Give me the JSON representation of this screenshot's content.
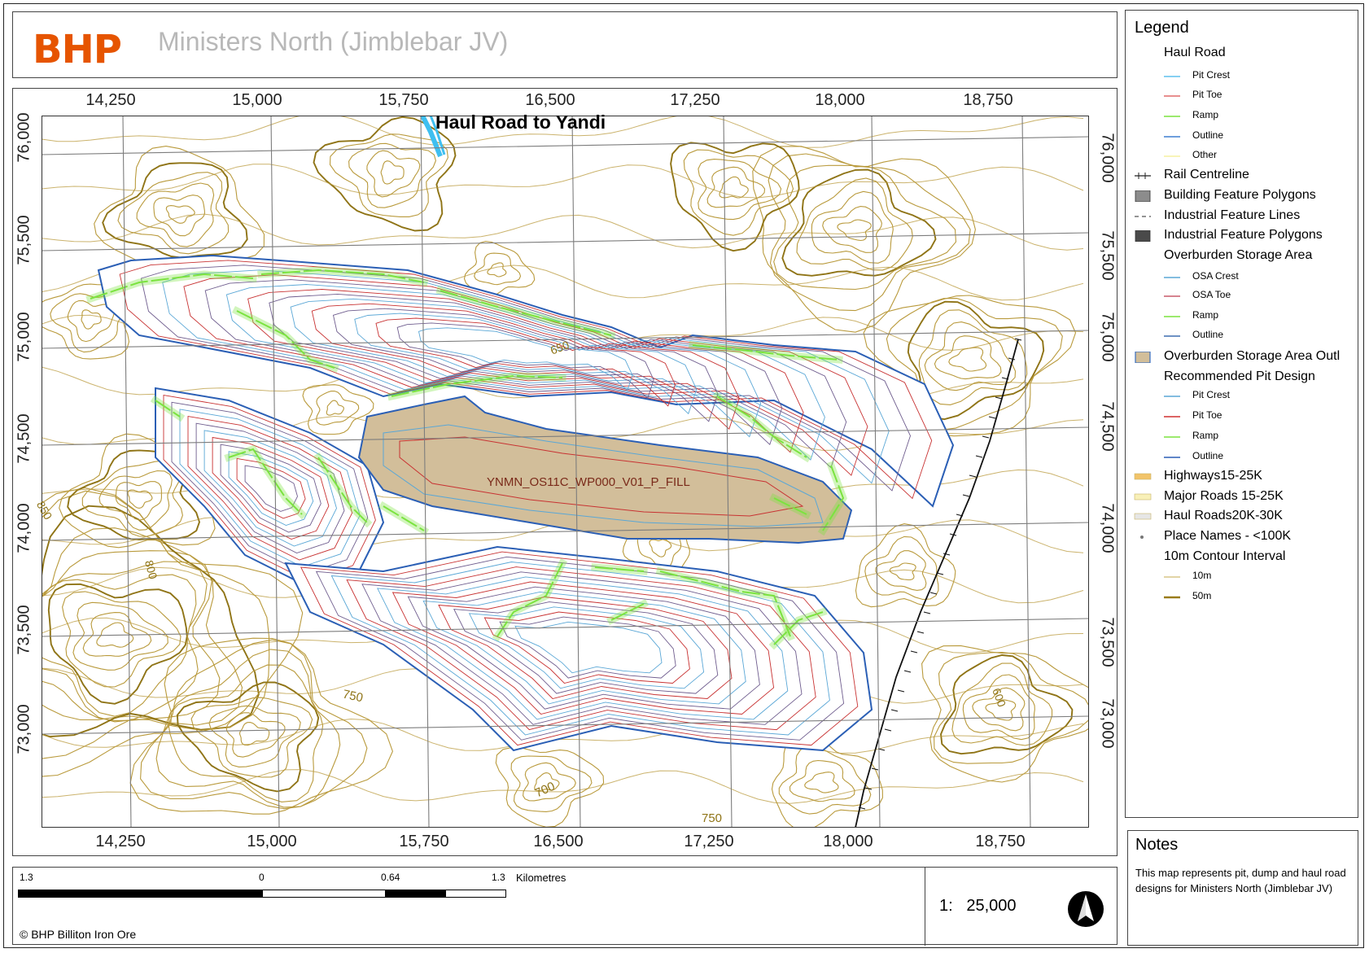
{
  "header": {
    "logo": "BHP",
    "title": "Ministers North (Jimblebar JV)"
  },
  "map": {
    "x_ticks_top": [
      "14,250",
      "15,000",
      "15,750",
      "16,500",
      "17,250",
      "18,000",
      "18,750"
    ],
    "x_ticks_bottom": [
      "14,250",
      "15,000",
      "15,750",
      "16,500",
      "17,250",
      "18,000",
      "18,750"
    ],
    "y_ticks_left": [
      "76,000",
      "75,500",
      "75,000",
      "74,500",
      "74,000",
      "73,500",
      "73,000"
    ],
    "y_ticks_right": [
      "76,000",
      "75,500",
      "75,000",
      "74,500",
      "74,000",
      "73,500",
      "73,000"
    ],
    "haul_road_label": "Haul Road to Yandi",
    "fill_label": "YNMN_OS11C_WP000_V01_P_FILL",
    "contour_labels": [
      "850",
      "800",
      "750",
      "700",
      "750",
      "650",
      "600"
    ],
    "colors": {
      "contour": "#b99a3c",
      "contour_major": "#8f7416",
      "pit_outline": "#2b5fb5",
      "pit_crest": "#5aa7d6",
      "pit_toe": "#c83232",
      "pit_bench": "#6f5d8e",
      "ramp": "#7be33f",
      "fill": "#d2be9a",
      "haul_road": "#3fbff0",
      "grid": "#7d7d7d"
    }
  },
  "legend": {
    "title": "Legend",
    "items": [
      {
        "kind": "head",
        "label": "Haul Road"
      },
      {
        "kind": "sub",
        "label": "Pit Crest",
        "sym": "line",
        "color": "#5ec0ee"
      },
      {
        "kind": "sub",
        "label": "Pit Toe",
        "sym": "line",
        "color": "#e06a6a"
      },
      {
        "kind": "sub",
        "label": "Ramp",
        "sym": "line",
        "color": "#7be33f"
      },
      {
        "kind": "sub",
        "label": "Outline",
        "sym": "line",
        "color": "#3f7fd0"
      },
      {
        "kind": "sub",
        "label": "Other",
        "sym": "line",
        "color": "#f6f0a0"
      },
      {
        "kind": "item",
        "label": "Rail Centreline",
        "sym": "rail",
        "color": "#222222"
      },
      {
        "kind": "item",
        "label": "Building Feature Polygons",
        "sym": "box",
        "color": "#8c8c8c"
      },
      {
        "kind": "item",
        "label": "Industrial Feature Lines",
        "sym": "dash",
        "color": "#555555"
      },
      {
        "kind": "item",
        "label": "Industrial Feature Polygons",
        "sym": "box",
        "color": "#4a4a4a"
      },
      {
        "kind": "head",
        "label": "Overburden Storage Area"
      },
      {
        "kind": "sub",
        "label": "OSA Crest",
        "sym": "line",
        "color": "#5aa7d6"
      },
      {
        "kind": "sub",
        "label": "OSA Toe",
        "sym": "line",
        "color": "#c85a6a"
      },
      {
        "kind": "sub",
        "label": "Ramp",
        "sym": "line",
        "color": "#7be33f"
      },
      {
        "kind": "sub",
        "label": "Outline",
        "sym": "line",
        "color": "#3f6fb0"
      },
      {
        "kind": "item",
        "label": "Overburden Storage Area Outl",
        "sym": "osa",
        "color": "#d2be9a"
      },
      {
        "kind": "head",
        "label": "Recommended Pit Design"
      },
      {
        "kind": "sub",
        "label": "Pit Crest",
        "sym": "line",
        "color": "#5aa7d6"
      },
      {
        "kind": "sub",
        "label": "Pit Toe",
        "sym": "line",
        "color": "#d03030"
      },
      {
        "kind": "sub",
        "label": "Ramp",
        "sym": "line",
        "color": "#7be33f"
      },
      {
        "kind": "sub",
        "label": "Outline",
        "sym": "line",
        "color": "#2b5fb5"
      },
      {
        "kind": "item",
        "label": "Highways15-25K",
        "sym": "road",
        "color": "#f2c46a"
      },
      {
        "kind": "item",
        "label": "Major Roads 15-25K",
        "sym": "road",
        "color": "#f8f0b8"
      },
      {
        "kind": "item",
        "label": "Haul Roads20K-30K",
        "sym": "road",
        "color": "#e6e6e6"
      },
      {
        "kind": "item",
        "label": "Place Names - <100K",
        "sym": "dot",
        "color": "#777777"
      },
      {
        "kind": "head",
        "label": "10m Contour Interval"
      },
      {
        "kind": "sub",
        "label": "10m",
        "sym": "line",
        "color": "#d8c688"
      },
      {
        "kind": "sub",
        "label": "50m",
        "sym": "thick",
        "color": "#9a7c1a"
      }
    ]
  },
  "notes": {
    "title": "Notes",
    "text": "This map represents pit, dump and haul road designs for Ministers North (Jimblebar JV)"
  },
  "scale": {
    "labels": [
      "1.3",
      "0",
      "0.64",
      "1.3"
    ],
    "unit": "Kilometres",
    "ratio_prefix": "1:",
    "ratio": "25,000",
    "copyright": "© BHP Billiton Iron Ore"
  }
}
